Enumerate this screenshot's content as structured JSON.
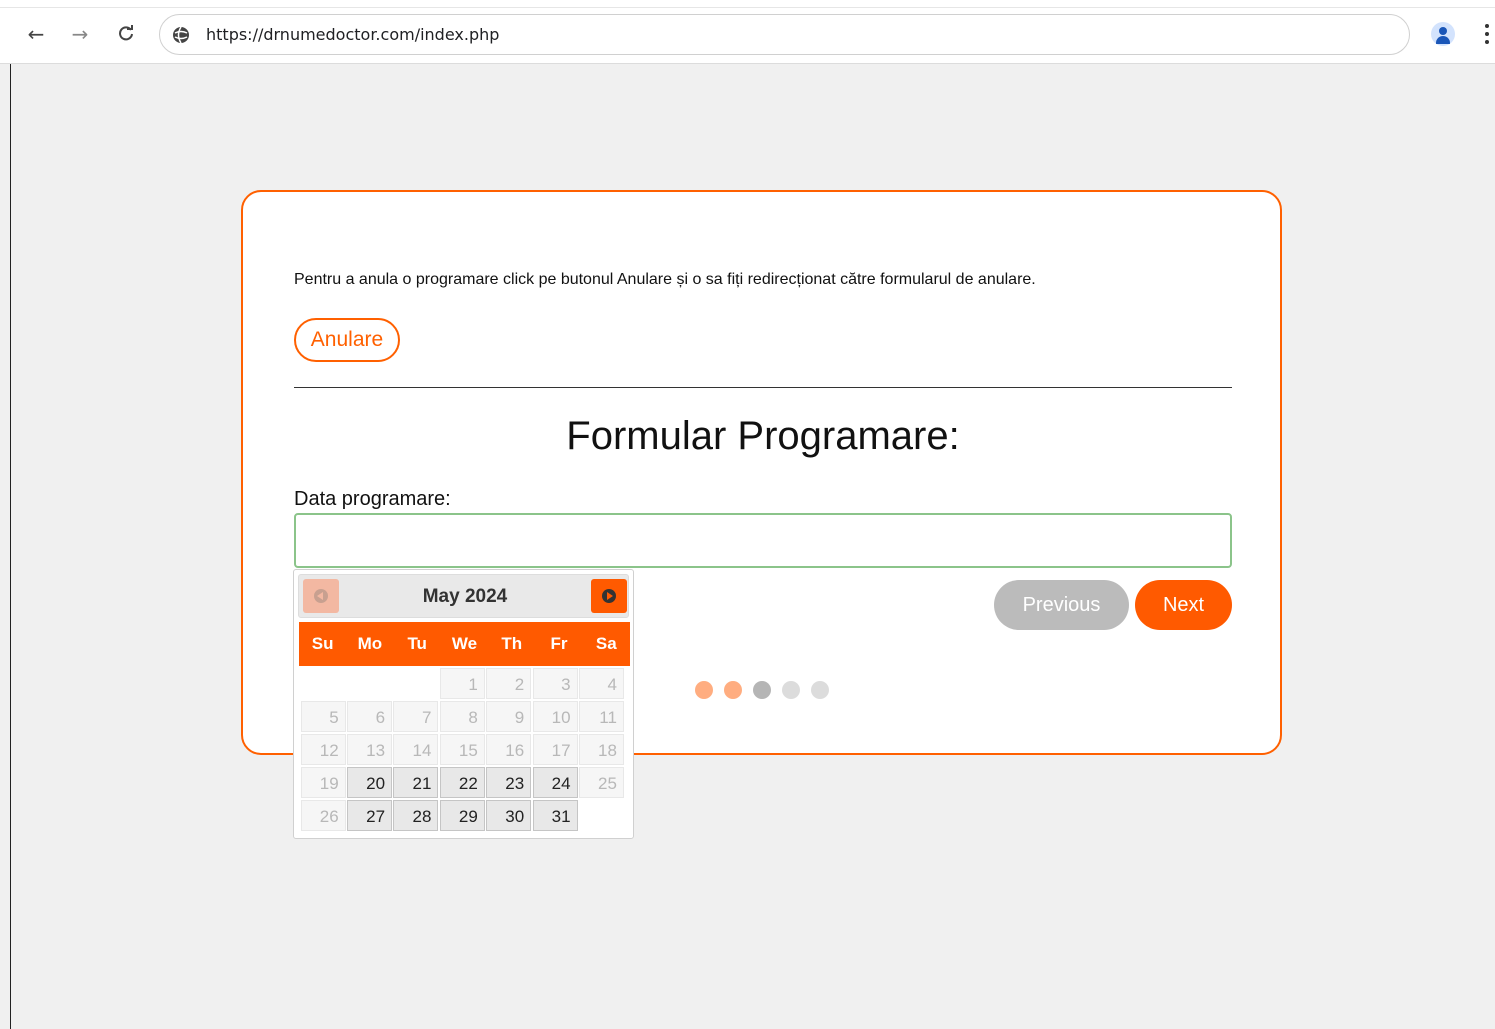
{
  "browser": {
    "url": "https://drnumedoctor.com/index.php",
    "back_icon": "←",
    "forward_icon": "→",
    "reload_icon": "C"
  },
  "card": {
    "cancel_instructions": "Pentru a anula o programare click pe butonul Anulare și o sa fiți redirecționat către formularul de anulare.",
    "cancel_button": "Anulare",
    "form_title": "Formular Programare:",
    "date_label": "Data programare:",
    "date_value": "",
    "previous_button": "Previous",
    "next_button": "Next",
    "steps": [
      "done",
      "done",
      "active",
      "todo",
      "todo"
    ]
  },
  "datepicker": {
    "month_title": "May 2024",
    "weekdays": [
      "Su",
      "Mo",
      "Tu",
      "We",
      "Th",
      "Fr",
      "Sa"
    ],
    "weeks": [
      [
        null,
        null,
        null,
        {
          "d": "1",
          "s": "disabled"
        },
        {
          "d": "2",
          "s": "disabled"
        },
        {
          "d": "3",
          "s": "disabled"
        },
        {
          "d": "4",
          "s": "disabled"
        }
      ],
      [
        {
          "d": "5",
          "s": "disabled"
        },
        {
          "d": "6",
          "s": "disabled"
        },
        {
          "d": "7",
          "s": "disabled"
        },
        {
          "d": "8",
          "s": "disabled"
        },
        {
          "d": "9",
          "s": "disabled"
        },
        {
          "d": "10",
          "s": "disabled"
        },
        {
          "d": "11",
          "s": "disabled"
        }
      ],
      [
        {
          "d": "12",
          "s": "disabled"
        },
        {
          "d": "13",
          "s": "disabled"
        },
        {
          "d": "14",
          "s": "disabled"
        },
        {
          "d": "15",
          "s": "disabled"
        },
        {
          "d": "16",
          "s": "disabled"
        },
        {
          "d": "17",
          "s": "disabled"
        },
        {
          "d": "18",
          "s": "disabled"
        }
      ],
      [
        {
          "d": "19",
          "s": "disabled"
        },
        {
          "d": "20",
          "s": "enabled"
        },
        {
          "d": "21",
          "s": "enabled"
        },
        {
          "d": "22",
          "s": "enabled"
        },
        {
          "d": "23",
          "s": "enabled"
        },
        {
          "d": "24",
          "s": "enabled"
        },
        {
          "d": "25",
          "s": "disabled"
        }
      ],
      [
        {
          "d": "26",
          "s": "disabled"
        },
        {
          "d": "27",
          "s": "enabled"
        },
        {
          "d": "28",
          "s": "enabled"
        },
        {
          "d": "29",
          "s": "enabled"
        },
        {
          "d": "30",
          "s": "enabled"
        },
        {
          "d": "31",
          "s": "enabled"
        },
        null
      ]
    ]
  },
  "colors": {
    "accent": "#ff5a00",
    "input_border": "#8bc48a",
    "step_done": "#ffad80",
    "step_active": "#b5b5b5"
  }
}
